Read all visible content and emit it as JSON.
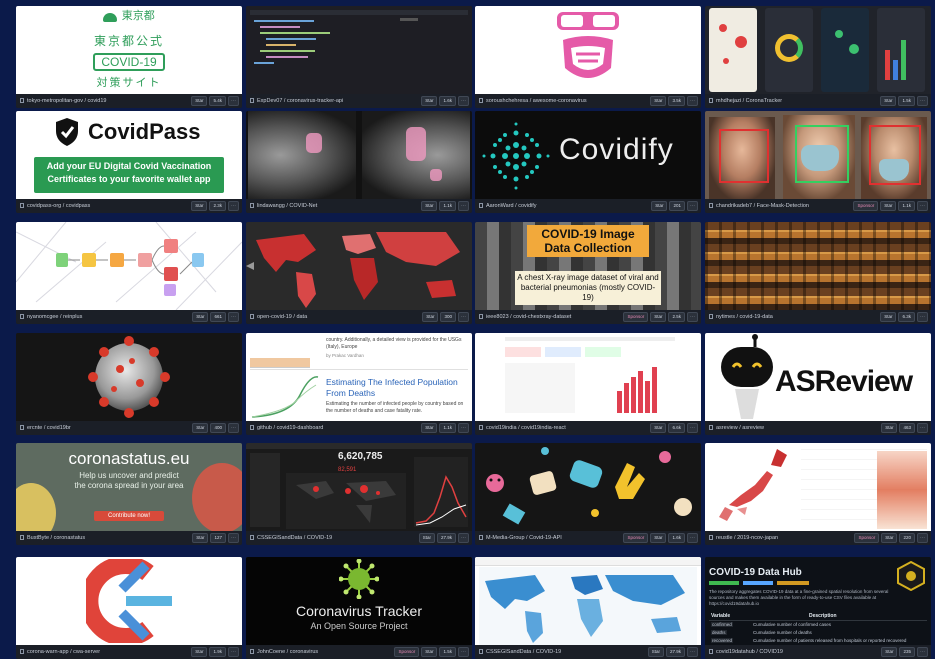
{
  "cards": [
    {
      "repo": "tokyo-metropolitan-gov / covid19",
      "buttons": [
        "Star",
        "5.4k"
      ],
      "thumb": {
        "org": "東京都",
        "title": "東京都公式",
        "badge": "COVID-19",
        "subtitle": "対策サイト"
      }
    },
    {
      "repo": "ExpDev07 / coronavirus-tracker-api",
      "buttons": [
        "Star",
        "1.6k"
      ],
      "thumb": {}
    },
    {
      "repo": "soroushchehresa / awesome-coronavirus",
      "buttons": [
        "Star",
        "3.5k"
      ],
      "thumb": {}
    },
    {
      "repo": "mhdhejazi / CoronaTracker",
      "buttons": [
        "Star",
        "1.5k"
      ],
      "thumb": {}
    },
    {
      "repo": "covidpass-org / covidpass",
      "buttons": [
        "Star",
        "2.3k"
      ],
      "thumb": {
        "title": "CovidPass",
        "banner": "Add your EU Digital Covid Vaccination Certificates to your favorite wallet app"
      }
    },
    {
      "repo": "lindawangg / COVID-Net",
      "buttons": [
        "Star",
        "1.1k"
      ],
      "thumb": {}
    },
    {
      "repo": "AaronWard / covidify",
      "buttons": [
        "Star",
        "201"
      ],
      "thumb": {
        "title": "Covidify"
      }
    },
    {
      "repo": "chandrikadeb7 / Face-Mask-Detection",
      "buttons": [
        "Sponsor",
        "Star",
        "1.1k"
      ],
      "thumb": {}
    },
    {
      "repo": "nyanomcgee / reinplus",
      "buttons": [
        "Star",
        "661"
      ],
      "thumb": {}
    },
    {
      "repo": "open-covid-19 / data",
      "buttons": [
        "Star",
        "300"
      ],
      "thumb": {}
    },
    {
      "repo": "ieee8023 / covid-chestxray-dataset",
      "buttons": [
        "Sponsor",
        "Star",
        "2.5k"
      ],
      "thumb": {
        "title": "COVID-19 Image Data Collection",
        "caption": "A chest X-ray image dataset of viral and bacterial pneumonias (mostly COVID-19)"
      }
    },
    {
      "repo": "nytimes / covid-19-data",
      "buttons": [
        "Star",
        "6.3k"
      ],
      "thumb": {}
    },
    {
      "repo": "ercnte / covid19br",
      "buttons": [
        "Star",
        "400"
      ],
      "thumb": {}
    },
    {
      "repo": "github / covid19-dashboard",
      "buttons": [
        "Star",
        "1.1k"
      ],
      "thumb": {
        "title": "Estimating The Infected Population From Deaths",
        "snippet": "country. Additionally, a detailed view is provided for the USGs (Italy), Europe",
        "author": "by Prakac Vardhan",
        "desc": "Estimating the number of infected people by country based on the number of deaths and case fatality rate."
      }
    },
    {
      "repo": "covid19india / covid19india-react",
      "buttons": [
        "Star",
        "6.6k"
      ],
      "thumb": {}
    },
    {
      "repo": "asreview / asreview",
      "buttons": [
        "Star",
        "463"
      ],
      "thumb": {
        "title": "ASReview"
      }
    },
    {
      "repo": "BustByte / coronastatus",
      "buttons": [
        "Star",
        "127"
      ],
      "thumb": {
        "title": "coronastatus.eu",
        "body": "Help us uncover and predict the corona spread in your area",
        "cta": "Contribute now!"
      }
    },
    {
      "repo": "CSSEGISandData / COVID-19",
      "buttons": [
        "Star",
        "27.9k"
      ],
      "thumb": {
        "stat1": "6,620,785",
        "stat2": "82,591"
      }
    },
    {
      "repo": "M-Media-Group / Covid-19-API",
      "buttons": [
        "Sponsor",
        "Star",
        "1.6k"
      ],
      "thumb": {}
    },
    {
      "repo": "reustle / 2019-ncov-japan",
      "buttons": [
        "Sponsor",
        "Star",
        "220"
      ],
      "thumb": {}
    },
    {
      "repo": "corona-warn-app / cwa-server",
      "buttons": [
        "Star",
        "1.9k"
      ],
      "thumb": {}
    },
    {
      "repo": "JohnCoene / coronavirus",
      "buttons": [
        "Sponsor",
        "Star",
        "1.5k"
      ],
      "thumb": {
        "title": "Coronavirus Tracker",
        "subtitle": "An Open Source Project"
      }
    },
    {
      "repo": "CSSEGISandData / COVID-19",
      "buttons": [
        "Star",
        "27.9k"
      ],
      "thumb": {}
    },
    {
      "repo": "covid19datahub / COVID19",
      "buttons": [
        "Star",
        "235"
      ],
      "thumb": {
        "title": "COVID-19 Data Hub",
        "desc": "The repository aggregates COVID-19 data at a fine-grained spatial resolution from several sources and makes them available in the form of ready-to-use CSV files available at https://covid19datahub.io",
        "col1": "Variable",
        "col2": "Description",
        "rows": [
          [
            "confirmed",
            "Cumulative number of confirmed cases"
          ],
          [
            "deaths",
            "Cumulative number of deaths"
          ],
          [
            "recovered",
            "Cumulative number of patients released from hospitals or reported recovered"
          ]
        ]
      }
    }
  ],
  "colors": {
    "bg": "#0b1a4a",
    "card": "#1b1f27"
  }
}
